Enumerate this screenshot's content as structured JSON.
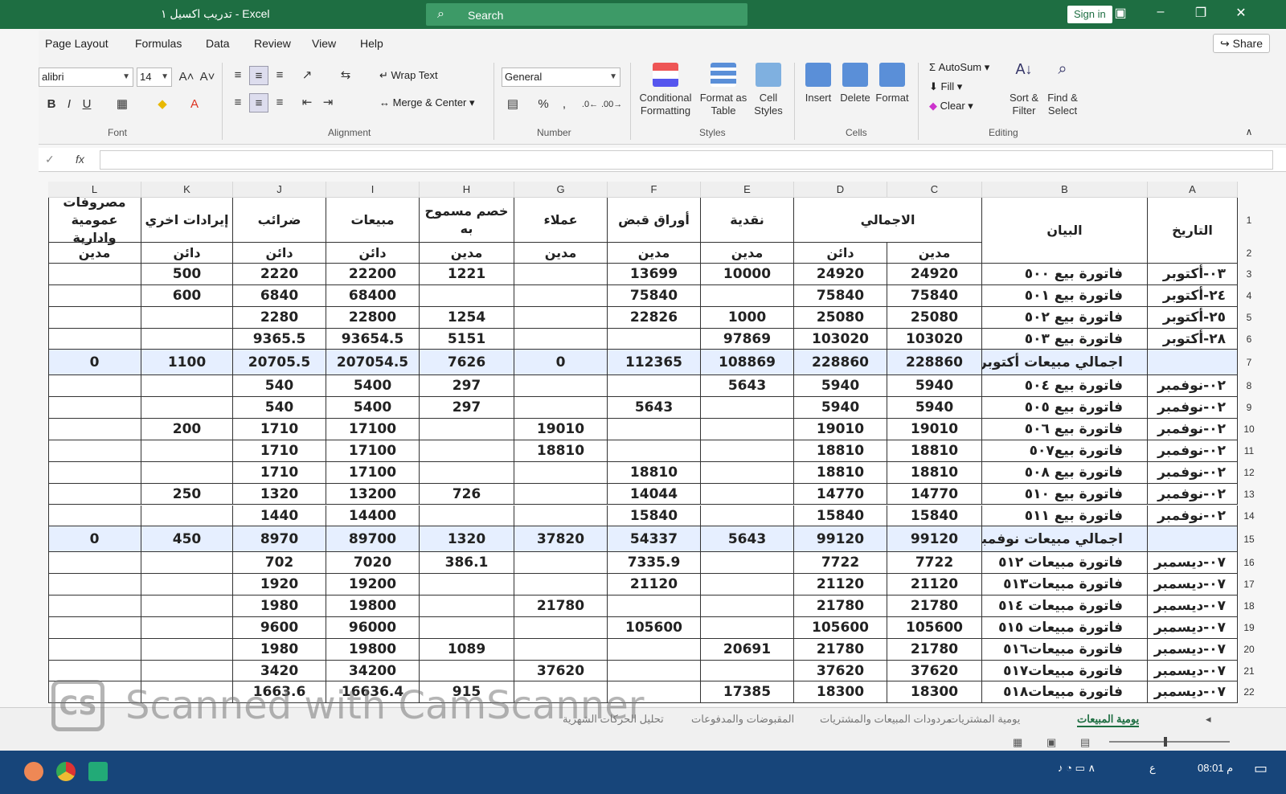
{
  "window": {
    "title": "تدريب اكسيل ١ - Excel",
    "search_label": "Search",
    "sign_in": "Sign in",
    "share": "Share"
  },
  "menu": [
    "Page Layout",
    "Formulas",
    "Data",
    "Review",
    "View",
    "Help"
  ],
  "ribbon": {
    "font_name": "alibri",
    "font_size": "14",
    "wrap_text": "Wrap Text",
    "merge_center": "Merge & Center",
    "number_format": "General",
    "conditional_formatting": [
      "Conditional",
      "Formatting"
    ],
    "format_as_table": [
      "Format as",
      "Table"
    ],
    "cell_styles": [
      "Cell",
      "Styles"
    ],
    "insert": "Insert",
    "delete": "Delete",
    "format": "Format",
    "autosum": "AutoSum",
    "fill": "Fill",
    "clear": "Clear",
    "sort_filter": [
      "Sort &",
      "Filter"
    ],
    "find_select": [
      "Find &",
      "Select"
    ],
    "groups": [
      "Font",
      "Alignment",
      "Number",
      "Styles",
      "Cells",
      "Editing"
    ]
  },
  "formula_bar": {
    "fx": "fx"
  },
  "columns": [
    "L",
    "K",
    "J",
    "I",
    "H",
    "G",
    "F",
    "E",
    "D",
    "C",
    "B",
    "A"
  ],
  "row_numbers": [
    "1",
    "2",
    "3",
    "4",
    "5",
    "6",
    "7",
    "8",
    "9",
    "10",
    "11",
    "12",
    "13",
    "14",
    "15",
    "16",
    "17",
    "18",
    "19",
    "20",
    "21",
    "22"
  ],
  "headers": {
    "L": "مصروفات عمومية وادارية",
    "K": "إيرادات اخري",
    "J": "ضرائب",
    "I": "مبيعات",
    "H": "خصم مسموح به",
    "G": "عملاء",
    "F": "أوراق قبض",
    "E": "نقدية",
    "CD": "الاجمالي",
    "B": "البيان",
    "A": "التاريخ"
  },
  "subheaders": {
    "L": "مدين",
    "K": "دائن",
    "J": "دائن",
    "I": "دائن",
    "H": "مدين",
    "G": "مدين",
    "F": "مدين",
    "E": "مدين",
    "D": "دائن",
    "C": "مدين"
  },
  "rows": [
    {
      "L": "",
      "K": "500",
      "J": "2220",
      "I": "22200",
      "H": "1221",
      "G": "",
      "F": "13699",
      "E": "10000",
      "D": "24920",
      "C": "24920",
      "B": "فاتورة بيع ٥٠٠",
      "A": "٠٣-أكتوبر"
    },
    {
      "L": "",
      "K": "600",
      "J": "6840",
      "I": "68400",
      "H": "",
      "G": "",
      "F": "75840",
      "E": "",
      "D": "75840",
      "C": "75840",
      "B": "فاتورة بيع ٥٠١",
      "A": "٢٤-أكتوبر"
    },
    {
      "L": "",
      "K": "",
      "J": "2280",
      "I": "22800",
      "H": "1254",
      "G": "",
      "F": "22826",
      "E": "1000",
      "D": "25080",
      "C": "25080",
      "B": "فاتورة بيع ٥٠٢",
      "A": "٢٥-أكتوبر"
    },
    {
      "L": "",
      "K": "",
      "J": "9365.5",
      "I": "93654.5",
      "H": "5151",
      "G": "",
      "F": "",
      "E": "97869",
      "D": "103020",
      "C": "103020",
      "B": "فاتورة بيع ٥٠٣",
      "A": "٢٨-أكتوبر"
    },
    {
      "L": "0",
      "K": "1100",
      "J": "20705.5",
      "I": "207054.5",
      "H": "7626",
      "G": "0",
      "F": "112365",
      "E": "108869",
      "D": "228860",
      "C": "228860",
      "B": "اجمالي مبيعات أكتوبر",
      "A": "",
      "total": true
    },
    {
      "L": "",
      "K": "",
      "J": "540",
      "I": "5400",
      "H": "297",
      "G": "",
      "F": "",
      "E": "5643",
      "D": "5940",
      "C": "5940",
      "B": "فاتورة بيع ٥٠٤",
      "A": "٠٢-نوفمبر"
    },
    {
      "L": "",
      "K": "",
      "J": "540",
      "I": "5400",
      "H": "297",
      "G": "",
      "F": "5643",
      "E": "",
      "D": "5940",
      "C": "5940",
      "B": "فاتورة بيع ٥٠٥",
      "A": "٠٢-نوفمبر"
    },
    {
      "L": "",
      "K": "200",
      "J": "1710",
      "I": "17100",
      "H": "",
      "G": "19010",
      "F": "",
      "E": "",
      "D": "19010",
      "C": "19010",
      "B": "فاتورة بيع ٥٠٦",
      "A": "٠٢-نوفمبر"
    },
    {
      "L": "",
      "K": "",
      "J": "1710",
      "I": "17100",
      "H": "",
      "G": "18810",
      "F": "",
      "E": "",
      "D": "18810",
      "C": "18810",
      "B": "فاتورة بيع٥٠٧",
      "A": "٠٢-نوفمبر"
    },
    {
      "L": "",
      "K": "",
      "J": "1710",
      "I": "17100",
      "H": "",
      "G": "",
      "F": "18810",
      "E": "",
      "D": "18810",
      "C": "18810",
      "B": "فاتورة بيع ٥٠٨",
      "A": "٠٢-نوفمبر"
    },
    {
      "L": "",
      "K": "250",
      "J": "1320",
      "I": "13200",
      "H": "726",
      "G": "",
      "F": "14044",
      "E": "",
      "D": "14770",
      "C": "14770",
      "B": "فاتورة بيع ٥١٠",
      "A": "٠٢-نوفمبر"
    },
    {
      "L": "",
      "K": "",
      "J": "1440",
      "I": "14400",
      "H": "",
      "G": "",
      "F": "15840",
      "E": "",
      "D": "15840",
      "C": "15840",
      "B": "فاتورة بيع ٥١١",
      "A": "٠٢-نوفمبر"
    },
    {
      "L": "0",
      "K": "450",
      "J": "8970",
      "I": "89700",
      "H": "1320",
      "G": "37820",
      "F": "54337",
      "E": "5643",
      "D": "99120",
      "C": "99120",
      "B": "اجمالي مبيعات نوفمبر",
      "A": "",
      "total": true
    },
    {
      "L": "",
      "K": "",
      "J": "702",
      "I": "7020",
      "H": "386.1",
      "G": "",
      "F": "7335.9",
      "E": "",
      "D": "7722",
      "C": "7722",
      "B": "فاتورة مبيعات ٥١٢",
      "A": "٠٧-ديسمبر"
    },
    {
      "L": "",
      "K": "",
      "J": "1920",
      "I": "19200",
      "H": "",
      "G": "",
      "F": "21120",
      "E": "",
      "D": "21120",
      "C": "21120",
      "B": "فاتورة مبيعات٥١٣",
      "A": "٠٧-ديسمبر"
    },
    {
      "L": "",
      "K": "",
      "J": "1980",
      "I": "19800",
      "H": "",
      "G": "21780",
      "F": "",
      "E": "",
      "D": "21780",
      "C": "21780",
      "B": "فاتورة مبيعات ٥١٤",
      "A": "٠٧-ديسمبر"
    },
    {
      "L": "",
      "K": "",
      "J": "9600",
      "I": "96000",
      "H": "",
      "G": "",
      "F": "105600",
      "E": "",
      "D": "105600",
      "C": "105600",
      "B": "فاتورة مبيعات ٥١٥",
      "A": "٠٧-ديسمبر"
    },
    {
      "L": "",
      "K": "",
      "J": "1980",
      "I": "19800",
      "H": "1089",
      "G": "",
      "F": "",
      "E": "20691",
      "D": "21780",
      "C": "21780",
      "B": "فاتورة مبيعات٥١٦",
      "A": "٠٧-ديسمبر"
    },
    {
      "L": "",
      "K": "",
      "J": "3420",
      "I": "34200",
      "H": "",
      "G": "37620",
      "F": "",
      "E": "",
      "D": "37620",
      "C": "37620",
      "B": "فاتورة مبيعات٥١٧",
      "A": "٠٧-ديسمبر"
    },
    {
      "L": "",
      "K": "",
      "J": "1663.6",
      "I": "16636.4",
      "H": "915",
      "G": "",
      "F": "",
      "E": "17385",
      "D": "18300",
      "C": "18300",
      "B": "فاتورة مبيعات٥١٨",
      "A": "٠٧-ديسمبر"
    }
  ],
  "sheet_tabs": [
    {
      "label": "يومية المبيعات",
      "active": true
    },
    {
      "label": "يومية المشتريات",
      "active": false
    },
    {
      "label": "مردودات المبيعات والمشتريات",
      "active": false
    },
    {
      "label": "المقبوضات والمدفوعات",
      "active": false
    },
    {
      "label": "تحليل الحركات الشهرية",
      "active": false
    }
  ],
  "status": {
    "zoom": 0.45
  },
  "taskbar": {
    "time": "08:01 م",
    "lang": "ع"
  },
  "watermark": {
    "logo": "CS",
    "text": "Scanned with CamScanner"
  },
  "colors": {
    "excel_green": "#1e6e42",
    "total_row": "#e6efff",
    "taskbar": "#17457a"
  }
}
